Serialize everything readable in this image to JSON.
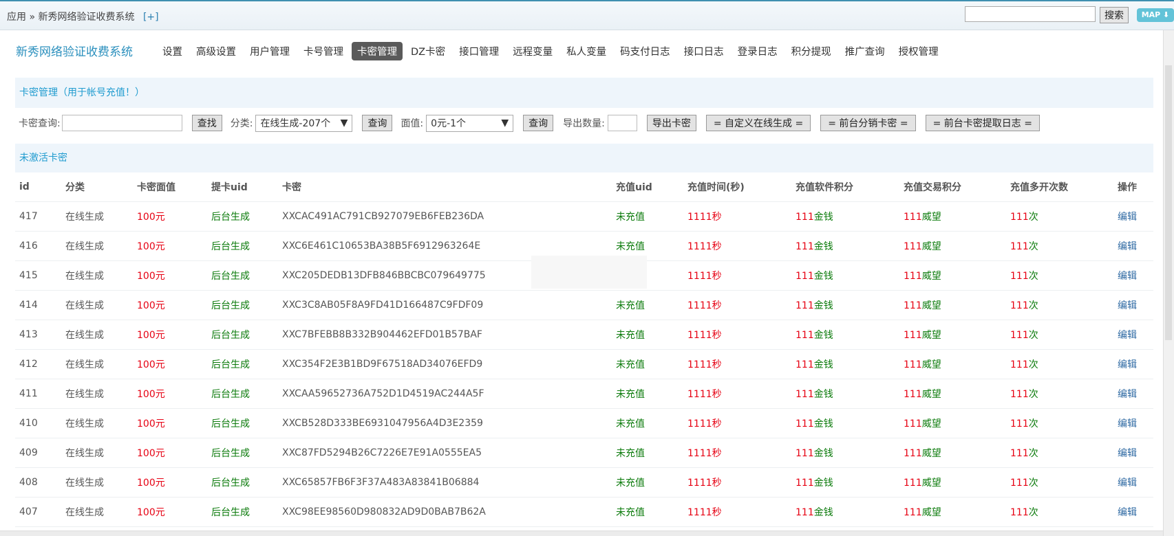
{
  "topbar": {
    "crumb_home": "应用",
    "crumb_sep": "»",
    "crumb_current": "新秀网络验证收费系统",
    "crumb_add": "[+]",
    "search_value": "",
    "search_label": "搜索",
    "map_label": "MAP ⬇"
  },
  "brand": "新秀网络验证收费系统",
  "nav": [
    {
      "label": "设置"
    },
    {
      "label": "高级设置"
    },
    {
      "label": "用户管理"
    },
    {
      "label": "卡号管理"
    },
    {
      "label": "卡密管理",
      "active": true
    },
    {
      "label": "DZ卡密"
    },
    {
      "label": "接口管理"
    },
    {
      "label": "远程变量"
    },
    {
      "label": "私人变量"
    },
    {
      "label": "码支付日志"
    },
    {
      "label": "接口日志"
    },
    {
      "label": "登录日志"
    },
    {
      "label": "积分提现"
    },
    {
      "label": "推广查询"
    },
    {
      "label": "授权管理"
    }
  ],
  "section1_title": "卡密管理（用于帐号充值！）",
  "toolbar": {
    "card_query_label": "卡密查询:",
    "card_query_value": "",
    "find_label": "查找",
    "category_label": "分类:",
    "category_value": "在线生成-207个",
    "query_label": "查询",
    "face_label": "面值:",
    "face_value": "0元-1个",
    "query2_label": "查询",
    "export_count_label": "导出数量:",
    "export_count_value": "",
    "export_label": "导出卡密",
    "custom_gen_label": "= 自定义在线生成 =",
    "front_dist_label": "= 前台分销卡密 =",
    "front_log_label": "= 前台卡密提取日志 ="
  },
  "section2_title": "未激活卡密",
  "table": {
    "headers": [
      "id",
      "分类",
      "卡密面值",
      "提卡uid",
      "卡密",
      "充值uid",
      "充值时间(秒)",
      "充值软件积分",
      "充值交易积分",
      "充值多开次数",
      "操作"
    ],
    "rows": [
      {
        "id": "417",
        "cat": "在线生成",
        "face": "100元",
        "uid": "后台生成",
        "code": "XXCAC491AC791CB927079EB6FEB236DA",
        "ruid": "未充值",
        "time_n": "1111",
        "time_u": "秒",
        "soft_n": "111",
        "soft_u": "金钱",
        "trade_n": "111",
        "trade_u": "威望",
        "multi_n": "111",
        "multi_u": "次",
        "op": "编辑"
      },
      {
        "id": "416",
        "cat": "在线生成",
        "face": "100元",
        "uid": "后台生成",
        "code": "XXC6E461C10653BA38B5F6912963264E",
        "ruid": "未充值",
        "time_n": "1111",
        "time_u": "秒",
        "soft_n": "111",
        "soft_u": "金钱",
        "trade_n": "111",
        "trade_u": "威望",
        "multi_n": "111",
        "multi_u": "次",
        "op": "编辑"
      },
      {
        "id": "415",
        "cat": "在线生成",
        "face": "100元",
        "uid": "后台生成",
        "code": "XXC205DEDB13DFB846BBCBC079649775",
        "ruid": "",
        "time_n": "1111",
        "time_u": "秒",
        "soft_n": "111",
        "soft_u": "金钱",
        "trade_n": "111",
        "trade_u": "威望",
        "multi_n": "111",
        "multi_u": "次",
        "op": "编辑"
      },
      {
        "id": "414",
        "cat": "在线生成",
        "face": "100元",
        "uid": "后台生成",
        "code": "XXC3C8AB05F8A9FD41D166487C9FDF09",
        "ruid": "未充值",
        "time_n": "1111",
        "time_u": "秒",
        "soft_n": "111",
        "soft_u": "金钱",
        "trade_n": "111",
        "trade_u": "威望",
        "multi_n": "111",
        "multi_u": "次",
        "op": "编辑"
      },
      {
        "id": "413",
        "cat": "在线生成",
        "face": "100元",
        "uid": "后台生成",
        "code": "XXC7BFEBB8B332B904462EFD01B57BAF",
        "ruid": "未充值",
        "time_n": "1111",
        "time_u": "秒",
        "soft_n": "111",
        "soft_u": "金钱",
        "trade_n": "111",
        "trade_u": "威望",
        "multi_n": "111",
        "multi_u": "次",
        "op": "编辑"
      },
      {
        "id": "412",
        "cat": "在线生成",
        "face": "100元",
        "uid": "后台生成",
        "code": "XXC354F2E3B1BD9F67518AD34076EFD9",
        "ruid": "未充值",
        "time_n": "1111",
        "time_u": "秒",
        "soft_n": "111",
        "soft_u": "金钱",
        "trade_n": "111",
        "trade_u": "威望",
        "multi_n": "111",
        "multi_u": "次",
        "op": "编辑"
      },
      {
        "id": "411",
        "cat": "在线生成",
        "face": "100元",
        "uid": "后台生成",
        "code": "XXCAA59652736A752D1D4519AC244A5F",
        "ruid": "未充值",
        "time_n": "1111",
        "time_u": "秒",
        "soft_n": "111",
        "soft_u": "金钱",
        "trade_n": "111",
        "trade_u": "威望",
        "multi_n": "111",
        "multi_u": "次",
        "op": "编辑"
      },
      {
        "id": "410",
        "cat": "在线生成",
        "face": "100元",
        "uid": "后台生成",
        "code": "XXCB528D333BE6931047956A4D3E2359",
        "ruid": "未充值",
        "time_n": "1111",
        "time_u": "秒",
        "soft_n": "111",
        "soft_u": "金钱",
        "trade_n": "111",
        "trade_u": "威望",
        "multi_n": "111",
        "multi_u": "次",
        "op": "编辑"
      },
      {
        "id": "409",
        "cat": "在线生成",
        "face": "100元",
        "uid": "后台生成",
        "code": "XXC87FD5294B26C7226E7E91A0555EA5",
        "ruid": "未充值",
        "time_n": "1111",
        "time_u": "秒",
        "soft_n": "111",
        "soft_u": "金钱",
        "trade_n": "111",
        "trade_u": "威望",
        "multi_n": "111",
        "multi_u": "次",
        "op": "编辑"
      },
      {
        "id": "408",
        "cat": "在线生成",
        "face": "100元",
        "uid": "后台生成",
        "code": "XXC65857FB6F3F37A483A83841B06884",
        "ruid": "未充值",
        "time_n": "1111",
        "time_u": "秒",
        "soft_n": "111",
        "soft_u": "金钱",
        "trade_n": "111",
        "trade_u": "威望",
        "multi_n": "111",
        "multi_u": "次",
        "op": "编辑"
      },
      {
        "id": "407",
        "cat": "在线生成",
        "face": "100元",
        "uid": "后台生成",
        "code": "XXC98EE98560D980832AD9D0BAB7B62A",
        "ruid": "未充值",
        "time_n": "1111",
        "time_u": "秒",
        "soft_n": "111",
        "soft_u": "金钱",
        "trade_n": "111",
        "trade_u": "威望",
        "multi_n": "111",
        "multi_u": "次",
        "op": "编辑"
      }
    ]
  }
}
